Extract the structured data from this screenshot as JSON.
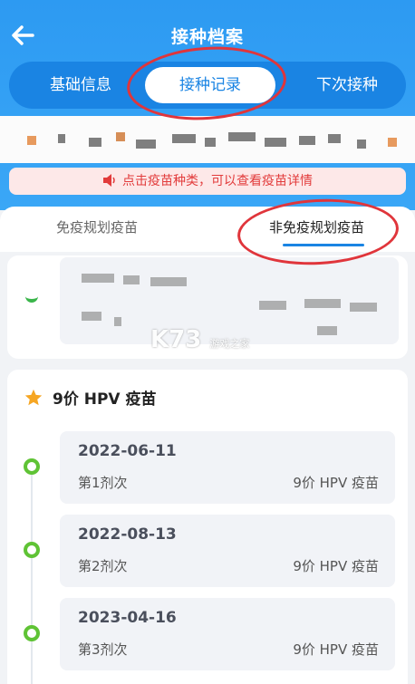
{
  "header": {
    "title": "接种档案",
    "back_icon": "arrow-left-icon"
  },
  "tabs": [
    {
      "label": "基础信息",
      "active": false
    },
    {
      "label": "接种记录",
      "active": true
    },
    {
      "label": "下次接种",
      "active": false
    }
  ],
  "notice": {
    "icon": "speaker-icon",
    "text": "点击疫苗种类，可以查看疫苗详情"
  },
  "subtabs": [
    {
      "label": "免疫规划疫苗",
      "active": false
    },
    {
      "label": "非免疫规划疫苗",
      "active": true
    }
  ],
  "vaccine": {
    "icon": "star-icon",
    "title": "9价 HPV 疫苗",
    "records": [
      {
        "date": "2022-06-11",
        "dose": "第1剂次",
        "name": "9价 HPV 疫苗"
      },
      {
        "date": "2022-08-13",
        "dose": "第2剂次",
        "name": "9价 HPV 疫苗"
      },
      {
        "date": "2023-04-16",
        "dose": "第3剂次",
        "name": "9价 HPV 疫苗"
      }
    ]
  },
  "watermark": {
    "main": "K73",
    "sub": "游戏之家"
  },
  "colors": {
    "primary": "#2d9af2",
    "tab_bg": "#1a84e3",
    "notice_text": "#e23b3b",
    "timeline_green": "#5fc335",
    "annotation_red": "#e0353b"
  }
}
